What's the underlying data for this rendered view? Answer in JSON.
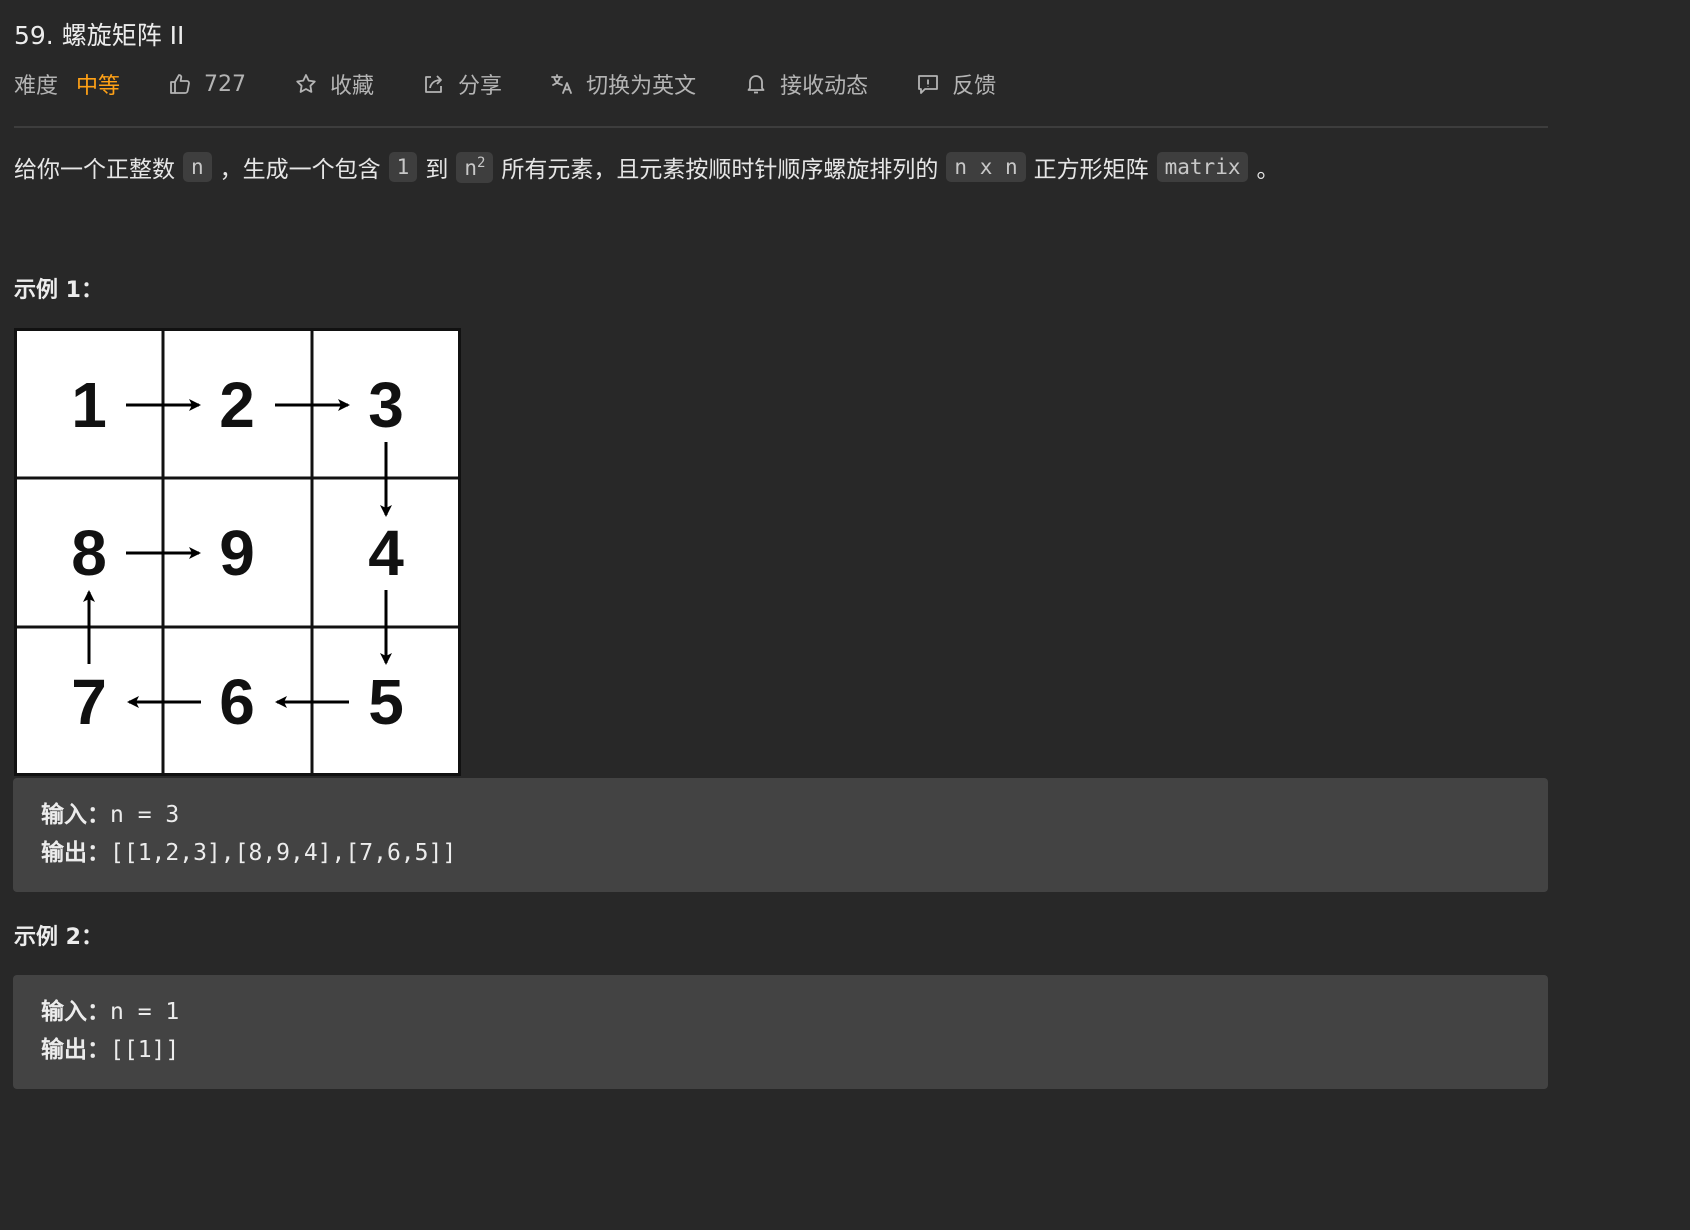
{
  "title": "59. 螺旋矩阵 II",
  "meta": {
    "difficulty_label": "难度",
    "difficulty_value": "中等",
    "difficulty_color": "#ffa116",
    "likes": "727",
    "collect": "收藏",
    "share": "分享",
    "switch_lang": "切换为英文",
    "subscribe": "接收动态",
    "feedback": "反馈"
  },
  "description": {
    "p1": "给你一个正整数",
    "c1": "n",
    "p2": "，生成一个包含",
    "c2": "1",
    "p3": "到",
    "c3_base": "n",
    "c3_sup": "2",
    "p4": "所有元素，且元素按顺时针顺序螺旋排列的",
    "c4": "n x n",
    "p5": "正方形矩阵",
    "c5": "matrix",
    "p6": "。"
  },
  "example1": {
    "title": "示例 1：",
    "matrix": [
      [
        "1",
        "2",
        "3"
      ],
      [
        "8",
        "9",
        "4"
      ],
      [
        "7",
        "6",
        "5"
      ]
    ],
    "input_label": "输入：",
    "input_value": "n = 3",
    "output_label": "输出：",
    "output_value": "[[1,2,3],[8,9,4],[7,6,5]]"
  },
  "example2": {
    "title": "示例 2：",
    "input_label": "输入：",
    "input_value": "n = 1",
    "output_label": "输出：",
    "output_value": "[[1]]"
  }
}
